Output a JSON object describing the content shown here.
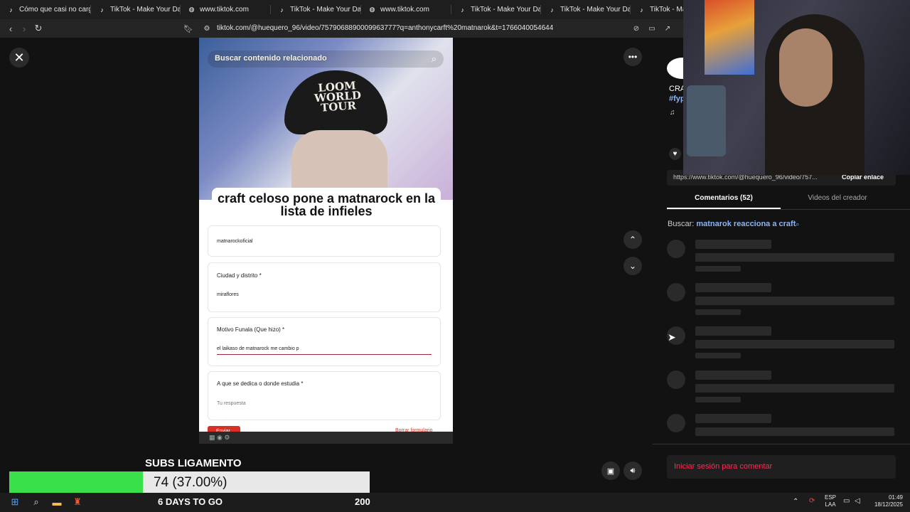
{
  "browser": {
    "tabs": [
      {
        "title": "Cómo que casi no cargo p",
        "icon": "tiktok-icon"
      },
      {
        "title": "TikTok - Make Your Day",
        "icon": "tiktok-icon"
      },
      {
        "title": "TikTok - Make Your Day",
        "icon": "tiktok-icon"
      },
      {
        "title": "www.tiktok.com",
        "icon": "globe-icon"
      },
      {
        "title": "TikTok - Make Your Day",
        "icon": "tiktok-icon"
      },
      {
        "title": "www.tiktok.com",
        "icon": "globe-icon"
      },
      {
        "title": "TikTok - Make Your Day",
        "icon": "tiktok-icon"
      },
      {
        "title": "TikTok - Make Your Day",
        "icon": "tiktok-icon"
      },
      {
        "title": "TikTok - Make",
        "icon": "tiktok-icon"
      }
    ],
    "url": "tiktok.com/@huequero_96/video/7579068890009963777?q=anthonycarft%20matnarok&t=1766040054644"
  },
  "video": {
    "search_placeholder": "Buscar contenido relacionado",
    "cap_text": "LOOM WORLD TOUR",
    "form_title": "craft celoso pone a matnarock en la lista de infieles",
    "fields": [
      {
        "question": "",
        "answer": "matnarockoficial"
      },
      {
        "question": "Ciudad y distrito *",
        "answer": "miraflores"
      },
      {
        "question": "Motivo Funala (Que hizo) *",
        "answer": "el laikaso de matnarock me cambio p"
      },
      {
        "question": "A que se dedica o donde estudia *",
        "answer": "Tu respuesta"
      }
    ],
    "submit_label": "Enviar",
    "clear_label": "Borrar formulario"
  },
  "right_panel": {
    "caption_partial": "CRA",
    "hashtag_partial": "#fyp",
    "share_link": "https://www.tiktok.com/@huequero_96/video/757...",
    "copy_link_label": "Copiar enlace",
    "tabs": [
      {
        "label": "Comentarios (52)",
        "active": true
      },
      {
        "label": "Videos del creador",
        "active": false
      }
    ],
    "search_prefix": "Buscar:",
    "search_term": "matnarok reacciona a craft",
    "login_label": "Iniciar sesión para comentar"
  },
  "stream_overlay": {
    "subs_title": "SUBS LIGAMENTO",
    "progress_text": "74 (37.00%)",
    "progress_fraction": 0.37,
    "days_to_go": "6 DAYS TO GO",
    "goal": "200"
  },
  "system_tray": {
    "lang_line1": "ESP",
    "lang_line2": "LAA",
    "time": "01:49",
    "date": "18/12/2025"
  },
  "colors": {
    "accent_red": "#fe2c55",
    "link_blue": "#8ab4f8",
    "progress_green": "#39e04a"
  }
}
